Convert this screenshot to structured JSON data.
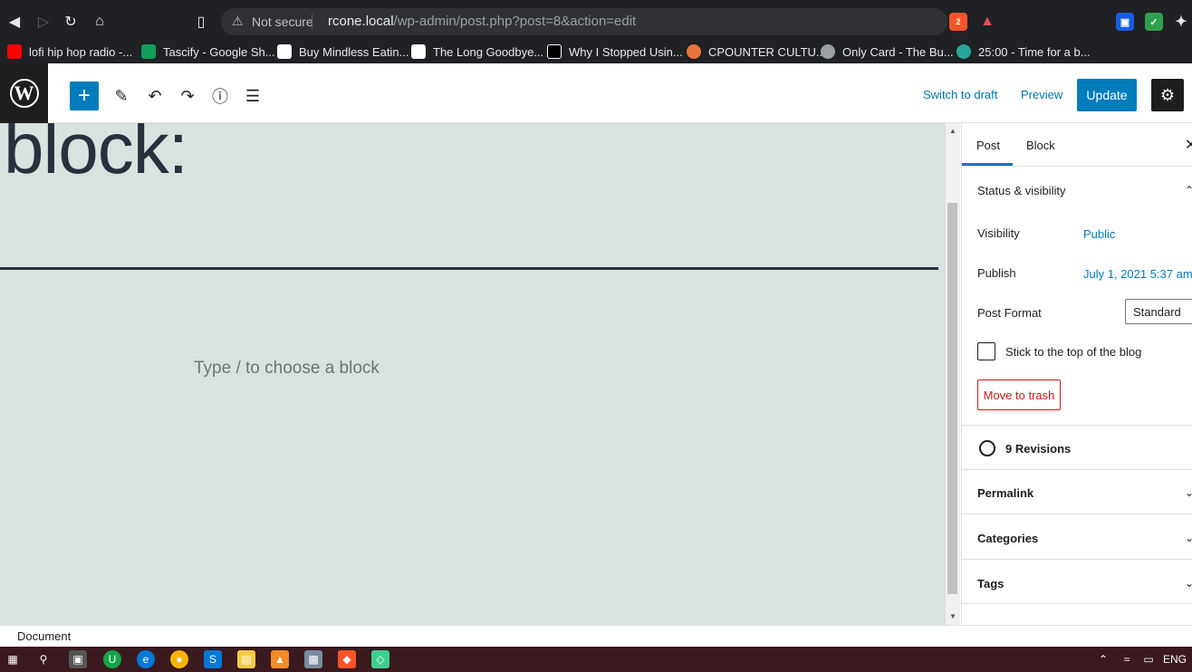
{
  "browser": {
    "security_label": "Not secure",
    "url_host": "rcone.local",
    "url_path": "/wp-admin/post.php?post=8&action=edit",
    "brave_badge": "2",
    "bookmarks": [
      {
        "label": "lofi hip hop radio -...",
        "color": "#ff0000"
      },
      {
        "label": "Tascify - Google Sh...",
        "color": "#0f9d58"
      },
      {
        "label": "Buy Mindless Eatin...",
        "color": "#ffffff"
      },
      {
        "label": "The Long Goodbye...",
        "color": "#ffffff"
      },
      {
        "label": "Why I Stopped Usin...",
        "color": "#000000"
      },
      {
        "label": "CPOUNTER CULTU...",
        "color": "#e8733a"
      },
      {
        "label": "Only Card - The Bu...",
        "color": "#9aa0a6"
      },
      {
        "label": "25:00 - Time for a b...",
        "color": "#26a69a"
      }
    ]
  },
  "toolbar": {
    "switch_draft": "Switch to draft",
    "preview": "Preview",
    "update": "Update"
  },
  "canvas": {
    "heading_text": "block:",
    "placeholder": "Type / to choose a block"
  },
  "sidebar": {
    "tab_post": "Post",
    "tab_block": "Block",
    "status_title": "Status & visibility",
    "visibility_label": "Visibility",
    "visibility_value": "Public",
    "publish_label": "Publish",
    "publish_value": "July 1, 2021 5:37 am",
    "format_label": "Post Format",
    "format_value": "Standard",
    "sticky_label": "Stick to the top of the blog",
    "trash": "Move to trash",
    "revisions": "9 Revisions",
    "permalink": "Permalink",
    "categories": "Categories",
    "tags": "Tags"
  },
  "footer": {
    "breadcrumb": "Document"
  },
  "taskbar": {
    "lang": "ENG"
  }
}
